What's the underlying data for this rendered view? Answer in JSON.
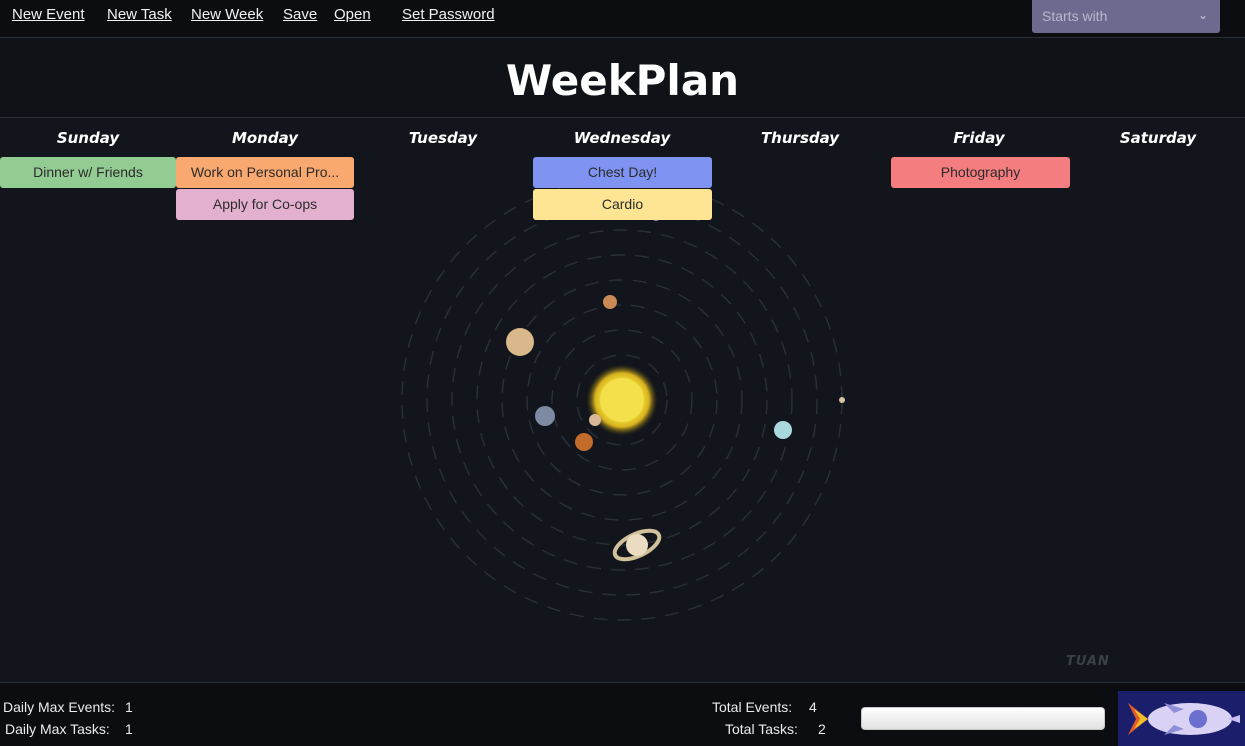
{
  "toolbar": {
    "new_event": "New Event",
    "new_task": "New Task",
    "new_week": "New Week",
    "save": "Save",
    "open": "Open",
    "set_password": "Set Password",
    "search_placeholder": "Starts with"
  },
  "title": "WeekPlan",
  "days": [
    "Sunday",
    "Monday",
    "Tuesday",
    "Wednesday",
    "Thursday",
    "Friday",
    "Saturday"
  ],
  "cards": {
    "sunday_0": "Dinner w/ Friends",
    "monday_0": "Work on Personal Pro...",
    "monday_1": "Apply for Co-ops",
    "wednesday_0": "Chest Day!",
    "wednesday_1": "Cardio",
    "friday_0": "Photography"
  },
  "colors": {
    "green": "#93cc93",
    "orange": "#f9a86f",
    "pink": "#e3b1cf",
    "blue": "#7e93f2",
    "yellow": "#fde594",
    "red": "#f47d80"
  },
  "footer": {
    "daily_max_events_label": "Daily Max Events:",
    "daily_max_events_value": "1",
    "daily_max_tasks_label": "Daily Max Tasks:",
    "daily_max_tasks_value": "1",
    "total_events_label": "Total Events:",
    "total_events_value": "4",
    "total_tasks_label": "Total Tasks:",
    "total_tasks_value": "2"
  }
}
